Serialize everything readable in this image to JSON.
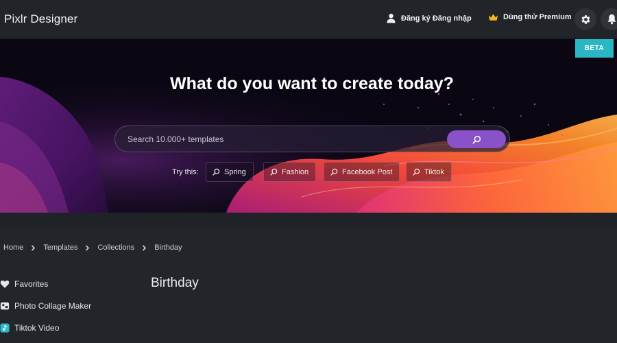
{
  "header": {
    "brand": "Pixlr Designer",
    "login_label": "Đăng ký Đăng nhập",
    "premium_label": "Dùng thử Premium",
    "icons": [
      "user-icon",
      "crown-icon",
      "gear-icon",
      "bell-icon"
    ]
  },
  "hero": {
    "beta_label": "BETA",
    "title": "What do you want to create today?",
    "search_placeholder": "Search 10.000+ templates",
    "try_label": "Try this:",
    "suggestions": [
      "Spring",
      "Fashion",
      "Facebook Post",
      "Tiktok"
    ]
  },
  "breadcrumb": [
    "Home",
    "Templates",
    "Collections",
    "Birthday"
  ],
  "sidebar": {
    "items": [
      {
        "label": "Favorites",
        "icon": "heart-icon"
      },
      {
        "label": "Photo Collage Maker",
        "icon": "collage-icon"
      },
      {
        "label": "Tiktok Video",
        "icon": "tiktok-icon"
      }
    ]
  },
  "main": {
    "heading": "Birthday"
  },
  "colors": {
    "accent": "#8a52c8",
    "beta": "#2ab6c3",
    "background": "#22262b",
    "header": "#212529"
  }
}
